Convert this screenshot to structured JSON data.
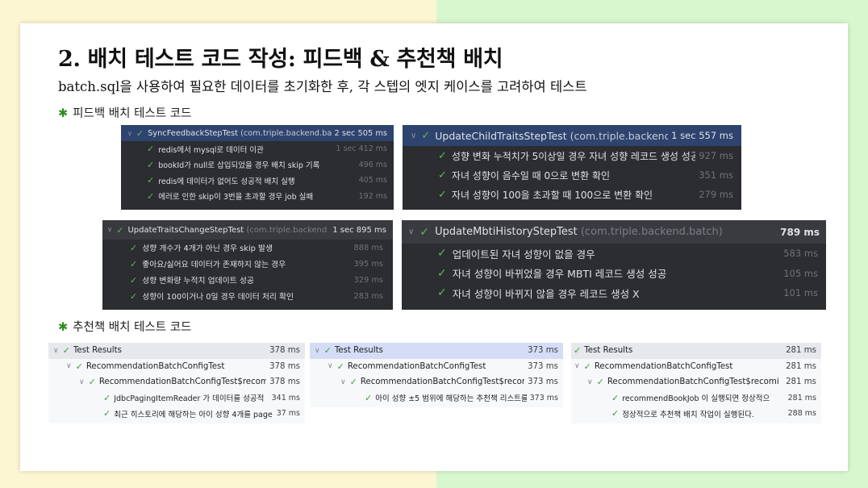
{
  "title": "2. 배치 테스트 코드 작성:  피드백 & 추천책 배치",
  "subtitle": "batch.sql을 사용하여 필요한 데이터를 초기화한 후, 각 스텝의 엣지 케이스를 고려하여 테스트",
  "sections": {
    "feedback": "피드백 배치 테스트 코드",
    "recommend": "추천책 배치 테스트 코드"
  },
  "panels": {
    "sync": {
      "name": "SyncFeedbackStepTest",
      "pkg": "(com.triple.backend.bat",
      "time": "2 sec 505 ms",
      "items": [
        {
          "label": "redis에서 mysql로 데이터 이관",
          "time": "1 sec 412 ms"
        },
        {
          "label": "bookId가 null로 삽입되었을 경우 배치 skip 기록",
          "time": "496 ms"
        },
        {
          "label": "redis에 데이터가 없어도 성공적 배치 실행",
          "time": "405 ms"
        },
        {
          "label": "에러로 인한 skip이 3번을 초과할 경우 job 실패",
          "time": "192 ms"
        }
      ]
    },
    "child": {
      "name": "UpdateChildTraitsStepTest",
      "pkg": "(com.triple.backend.ba",
      "time": "1 sec 557 ms",
      "items": [
        {
          "label": "성향 변화 누적치가 5이상일 경우 자녀 성향 레코드 생성 성공",
          "time": "927 ms"
        },
        {
          "label": "자녀 성향이 음수일 때 0으로 변환 확인",
          "time": "351 ms"
        },
        {
          "label": "자녀 성향이 100을 초과할 때 100으로 변환 확인",
          "time": "279 ms"
        }
      ]
    },
    "traits": {
      "name": "UpdateTraitsChangeStepTest",
      "pkg": "(com.triple.backend",
      "time": "1 sec 895 ms",
      "items": [
        {
          "label": "성향 개수가 4개가 아닌 경우 skip 발생",
          "time": "888 ms"
        },
        {
          "label": "좋아요/싫어요 데이터가 존재하지 않는 경우",
          "time": "395 ms"
        },
        {
          "label": "성향 변화량 누적치 업데이트 성공",
          "time": "329 ms"
        },
        {
          "label": "성향이 100이거나 0일 경우 데이터 처리 확인",
          "time": "283 ms"
        }
      ]
    },
    "mbti": {
      "name": "UpdateMbtiHistoryStepTest",
      "pkg": "(com.triple.backend.batch)",
      "time": "789 ms",
      "items": [
        {
          "label": "업데이트된 자녀 성향이 없을 경우",
          "time": "583 ms"
        },
        {
          "label": "자녀 성향이 바뀌었을 경우 MBTI 레코드 생성 성공",
          "time": "105 ms"
        },
        {
          "label": "자녀 성향이 바뀌지 않을 경우 레코드 생성 X",
          "time": "101 ms"
        }
      ]
    },
    "rec1": {
      "root": "Test Results",
      "root_time": "378 ms",
      "config": "RecommendationBatchConfigTest",
      "config_time": "378 ms",
      "inner": "RecommendationBatchConfigTest$recom",
      "inner_time": "378 ms",
      "items": [
        {
          "label": "JdbcPagingItemReader 가 데이터를 성공적",
          "time": "341 ms"
        },
        {
          "label": "최근 히스토리에 해당하는 아이 성향 4개를 page",
          "time": "37 ms"
        }
      ]
    },
    "rec2": {
      "root": "Test Results",
      "root_time": "373 ms",
      "config": "RecommendationBatchConfigTest",
      "config_time": "373 ms",
      "inner": "RecommendationBatchConfigTest$recom",
      "inner_time": "373 ms",
      "items": [
        {
          "label": "아이 성향 ±5 범위에 해당하는 추천책 리스트를",
          "time": "373 ms"
        }
      ]
    },
    "rec3": {
      "root": "Test Results",
      "root_time": "281 ms",
      "config": "RecommendationBatchConfigTest",
      "config_time": "281 ms",
      "inner": "RecommendationBatchConfigTest$recomi",
      "inner_time": "281 ms",
      "items": [
        {
          "label": "recommendBookJob 이 실행되면 정상적으",
          "time": "281 ms"
        },
        {
          "label": "정상적으로 추천책 배치 작업이 실행된다.",
          "time": "288 ms"
        }
      ]
    }
  },
  "icons": {
    "check": "check-icon",
    "chevron": "chevron-down-icon",
    "star": "asterisk-icon"
  },
  "colors": {
    "check_dark": "#5fb85f",
    "check_light": "#3f9a3f",
    "panel_dark": "#2b2d30",
    "selected_row": "#2e436e",
    "star": "#2e8b22"
  }
}
